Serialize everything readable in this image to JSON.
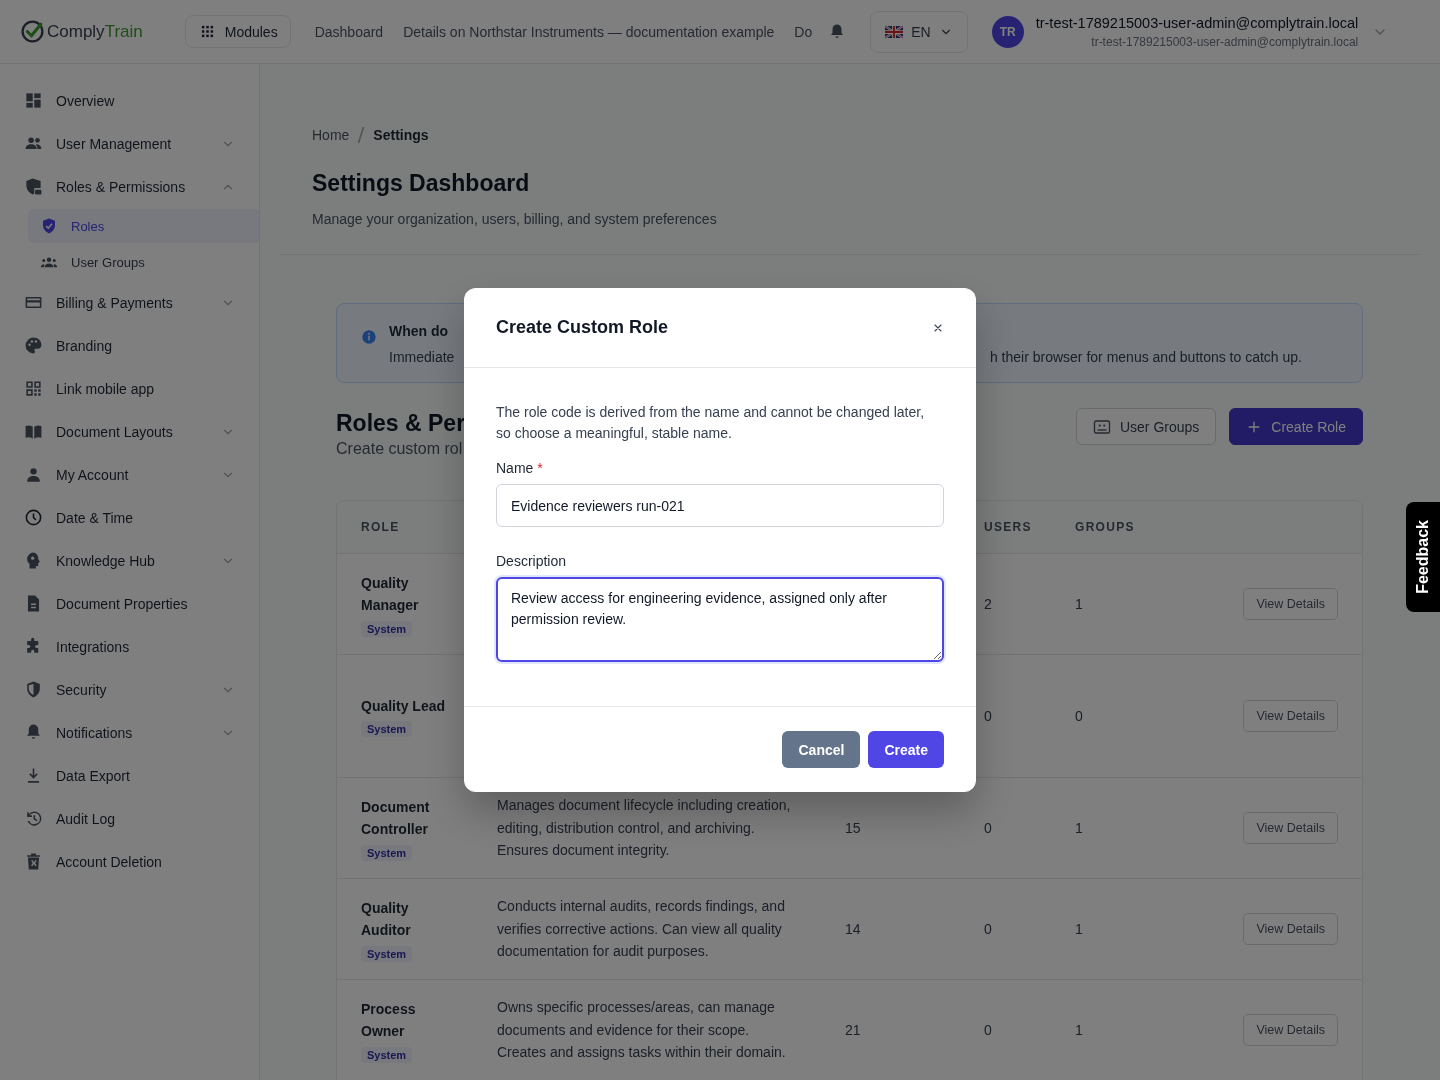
{
  "topbar": {
    "logo": {
      "first": "Comply",
      "second": "Train"
    },
    "modules_button": "Modules",
    "nav_links": [
      "Dashboard",
      "Details on Northstar Instruments — documentation example",
      "Do"
    ],
    "language": "EN",
    "avatar": "TR",
    "user_name": "tr-test-1789215003-user-admin@complytrain.local",
    "user_email": "tr-test-1789215003-user-admin@complytrain.local"
  },
  "sidebar": {
    "items": [
      {
        "label": "Overview",
        "selected": false
      },
      {
        "label": "User Management",
        "selected": false,
        "expanded": false
      },
      {
        "label": "Roles & Permissions",
        "selected": false,
        "expanded": true,
        "children": [
          {
            "label": "Roles",
            "selected": true
          },
          {
            "label": "User Groups",
            "selected": false
          }
        ]
      },
      {
        "label": "Billing & Payments",
        "selected": false,
        "expanded": false
      },
      {
        "label": "Branding",
        "selected": false
      },
      {
        "label": "Link mobile app",
        "selected": false
      },
      {
        "label": "Document Layouts",
        "selected": false,
        "expanded": false
      },
      {
        "label": "My Account",
        "selected": false,
        "expanded": false
      },
      {
        "label": "Date & Time",
        "selected": false
      },
      {
        "label": "Knowledge Hub",
        "selected": false,
        "expanded": false
      },
      {
        "label": "Document Properties",
        "selected": false
      },
      {
        "label": "Integrations",
        "selected": false
      },
      {
        "label": "Security",
        "selected": false,
        "expanded": false
      },
      {
        "label": "Notifications",
        "selected": false,
        "expanded": false
      },
      {
        "label": "Data Export",
        "selected": false
      },
      {
        "label": "Audit Log",
        "selected": false
      },
      {
        "label": "Account Deletion",
        "selected": false
      }
    ]
  },
  "breadcrumb": [
    "Home",
    "Settings"
  ],
  "page_title": "Settings Dashboard",
  "page_subtitle": "Manage your organization, users, billing, and system preferences",
  "info_box": {
    "title": "When do",
    "body": "Immediate",
    "body_end": "h their browser for menus and buttons to catch up."
  },
  "section": {
    "title": "Roles & Per",
    "subtitle": "Create custom rol",
    "buttons": [
      {
        "label": "User Groups",
        "kind": "secondary"
      },
      {
        "label": "Create Role",
        "kind": "primary"
      }
    ]
  },
  "table": {
    "columns": [
      "ROLE",
      "USERS",
      "GROUPS"
    ],
    "rows": [
      {
        "role": "Quality Manager",
        "badge": "System",
        "users": "2",
        "groups": "1",
        "action": "View Details"
      },
      {
        "role": "Quality Lead",
        "badge": "System",
        "users": "0",
        "groups": "0",
        "action": "View Details"
      },
      {
        "role": "Document Controller",
        "badge": "System",
        "description": "Manages document lifecycle including creation, editing, distribution control, and archiving. Ensures document integrity.",
        "column_3": "15",
        "users": "0",
        "groups": "1",
        "action": "View Details"
      },
      {
        "role": "Quality Auditor",
        "badge": "System",
        "description": "Conducts internal audits, records findings, and verifies corrective actions. Can view all quality documentation for audit purposes.",
        "column_3": "14",
        "users": "0",
        "groups": "1",
        "action": "View Details"
      },
      {
        "role": "Process Owner",
        "badge": "System",
        "description": "Owns specific processes/areas, can manage documents and evidence for their scope. Creates and assigns tasks within their domain.",
        "column_3": "21",
        "users": "0",
        "groups": "1",
        "action": "View Details"
      }
    ]
  },
  "modal": {
    "title": "Create Custom Role",
    "intro": "The role code is derived from the name and cannot be changed later, so choose a meaningful, stable name.",
    "fields": [
      {
        "kind": "input",
        "label": "Name",
        "required_mark": "*",
        "value": "Evidence reviewers run-021",
        "focused": false
      },
      {
        "kind": "textarea",
        "label": "Description",
        "value": "Review access for engineering evidence, assigned only after permission review.",
        "focused": true
      }
    ],
    "buttons": [
      {
        "label": "Cancel",
        "kind": "secondary"
      },
      {
        "label": "Create",
        "kind": "primary"
      }
    ]
  },
  "feedback_tab": "Feedback"
}
